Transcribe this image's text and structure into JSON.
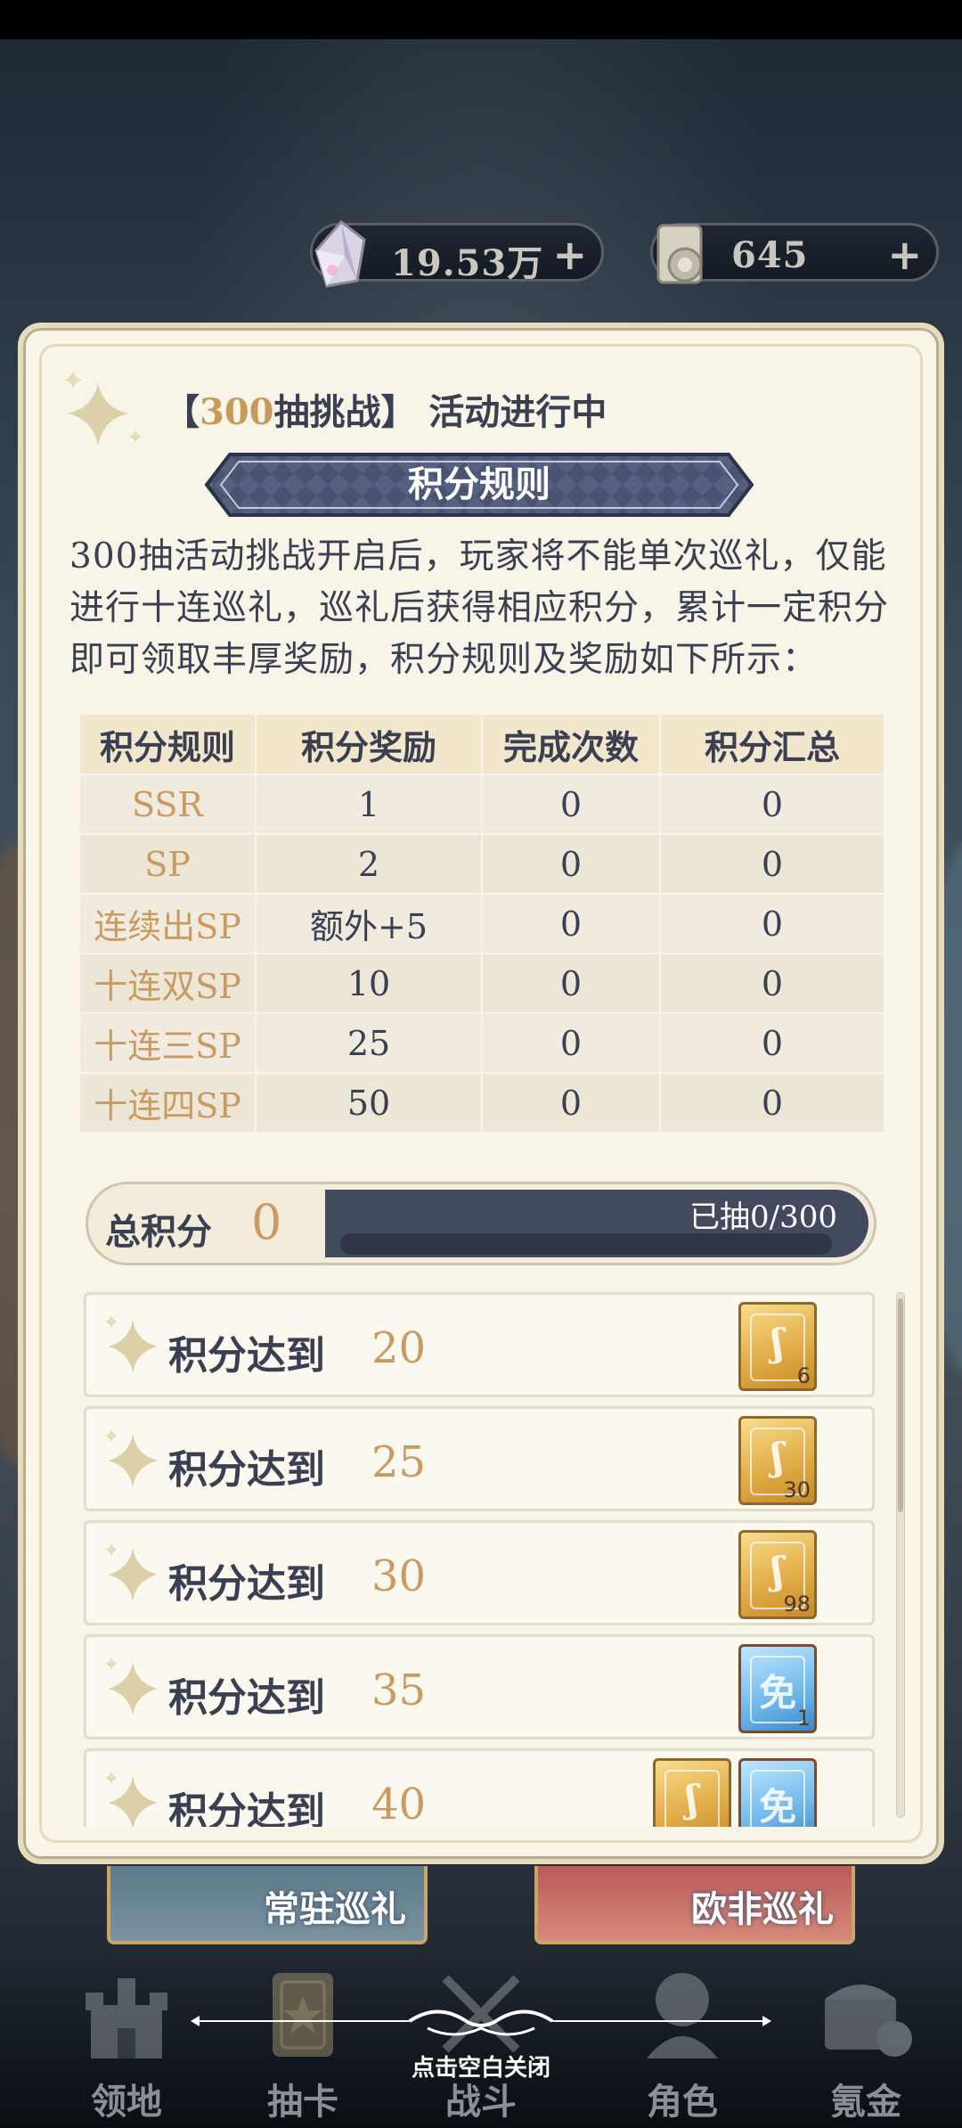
{
  "currencies": [
    {
      "icon": "crystal-icon",
      "value": "19.53万",
      "plus": "+"
    },
    {
      "icon": "scroll-icon",
      "value": "645",
      "plus": "+"
    }
  ],
  "activity": {
    "bracket_open": "【",
    "highlight": "300",
    "title_rest": "抽挑战】 活动进行中"
  },
  "rules": {
    "banner": "积分规则",
    "description": "300抽活动挑战开启后，玩家将不能单次巡礼，仅能进行十连巡礼，巡礼后获得相应积分，累计一定积分即可领取丰厚奖励，积分规则及奖励如下所示：",
    "headers": [
      "积分规则",
      "积分奖励",
      "完成次数",
      "积分汇总"
    ],
    "rows": [
      {
        "name": "SSR",
        "reward": "1",
        "count": "0",
        "total": "0"
      },
      {
        "name": "SP",
        "reward": "2",
        "count": "0",
        "total": "0"
      },
      {
        "name": "连续出SP",
        "reward": "额外+5",
        "count": "0",
        "total": "0"
      },
      {
        "name": "十连双SP",
        "reward": "10",
        "count": "0",
        "total": "0"
      },
      {
        "name": "十连三SP",
        "reward": "25",
        "count": "0",
        "total": "0"
      },
      {
        "name": "十连四SP",
        "reward": "50",
        "count": "0",
        "total": "0"
      }
    ]
  },
  "total": {
    "label": "总积分",
    "value": "0",
    "drawn": "已抽0/300",
    "progress": 0
  },
  "rewards": [
    {
      "label": "积分达到",
      "points": "20",
      "cards": [
        {
          "type": "gold",
          "count": "6"
        }
      ]
    },
    {
      "label": "积分达到",
      "points": "25",
      "cards": [
        {
          "type": "gold",
          "count": "30"
        }
      ]
    },
    {
      "label": "积分达到",
      "points": "30",
      "cards": [
        {
          "type": "gold",
          "count": "98"
        }
      ]
    },
    {
      "label": "积分达到",
      "points": "35",
      "cards": [
        {
          "type": "blue",
          "glyph": "免",
          "count": "1"
        }
      ]
    },
    {
      "label": "积分达到",
      "points": "40",
      "cards": [
        {
          "type": "gold",
          "count": ""
        },
        {
          "type": "blue",
          "glyph": "免",
          "count": ""
        }
      ]
    }
  ],
  "pools": [
    "常驻巡礼",
    "欧非巡礼"
  ],
  "nav": [
    {
      "label": "领地",
      "icon": "castle-icon"
    },
    {
      "label": "抽卡",
      "icon": "card-icon"
    },
    {
      "label": "战斗",
      "icon": "swords-icon"
    },
    {
      "label": "角色",
      "icon": "character-icon"
    },
    {
      "label": "氪金",
      "icon": "treasure-chest-icon"
    }
  ],
  "close_hint": "点击空白关闭",
  "colors": {
    "accent": "#c99a62",
    "text": "#3a3f52",
    "panel": "#f8f4e8",
    "banner": "#414a5f"
  }
}
